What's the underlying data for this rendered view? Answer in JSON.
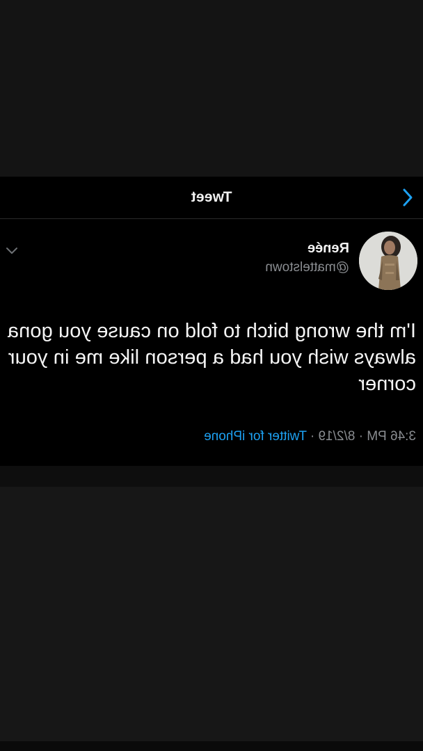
{
  "nav": {
    "title": "Tweet",
    "back_icon": "chevron-left-icon"
  },
  "tweet": {
    "display_name": "Renée",
    "handle": "@mattelstown",
    "text": "I'm the wrong bitch to fold on cause you gona always wish you had a person like me in your corner",
    "time": "3:46 PM",
    "dot1": " · ",
    "date": "8/2/19",
    "dot2": " · ",
    "source": "Twitter for iPhone",
    "more_icon": "chevron-down-icon",
    "avatar_icon": "profile-photo"
  },
  "colors": {
    "background": "#000000",
    "surrounding": "#141414",
    "link": "#1da1f2",
    "muted_text": "#8a8d91",
    "primary_text": "#f2f2f2"
  }
}
